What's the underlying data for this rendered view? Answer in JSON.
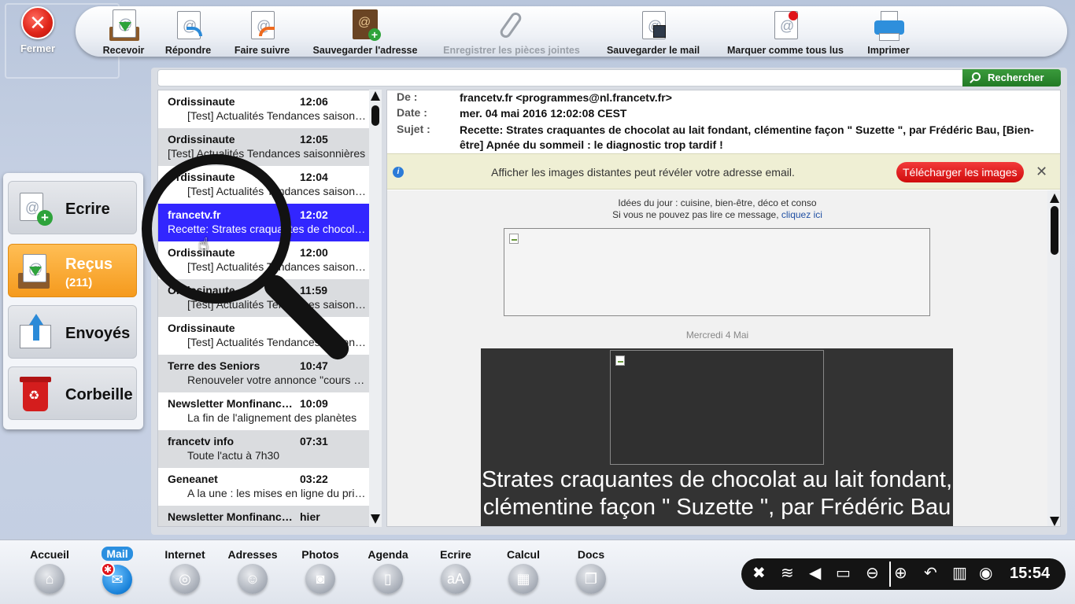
{
  "close": {
    "label": "Fermer"
  },
  "toolbar": {
    "buttons": [
      {
        "label": "Recevoir"
      },
      {
        "label": "Répondre"
      },
      {
        "label": "Faire suivre"
      },
      {
        "label": "Sauvegarder l'adresse"
      },
      {
        "label": "Enregistrer les pièces jointes"
      },
      {
        "label": "Sauvegarder le mail"
      },
      {
        "label": "Marquer comme tous lus"
      },
      {
        "label": "Imprimer"
      }
    ]
  },
  "sidebar": {
    "items": [
      {
        "label": "Ecrire"
      },
      {
        "label": "Reçus",
        "count": "(211)"
      },
      {
        "label": "Envoyés"
      },
      {
        "label": "Corbeille"
      }
    ]
  },
  "search": {
    "button_label": "Rechercher",
    "value": ""
  },
  "mail_list": [
    {
      "from": "Ordissinaute",
      "time": "12:06",
      "subject": "[Test] Actualités Tendances saisonnières"
    },
    {
      "from": "Ordissinaute",
      "time": "12:05",
      "subject": "[Test] Actualités Tendances saisonnières"
    },
    {
      "from": "Ordissinaute",
      "time": "12:04",
      "subject": "[Test] Actualités Tendances saisonnières"
    },
    {
      "from": "francetv.fr",
      "time": "12:02",
      "subject": "Recette: Strates craquantes de chocolat au lait fondant"
    },
    {
      "from": "Ordissinaute",
      "time": "12:00",
      "subject": "[Test] Actualités Tendances saisonnières"
    },
    {
      "from": "Ordissinaute",
      "time": "11:59",
      "subject": "[Test] Actualités Tendances saisonnières"
    },
    {
      "from": "Ordissinaute",
      "time": "",
      "subject": "[Test] Actualités Tendances saisonnières"
    },
    {
      "from": "Terre des Seniors",
      "time": "10:47",
      "subject": "Renouveler votre annonce \"cours de\""
    },
    {
      "from": "Newsletter Monfinancier",
      "time": "10:09",
      "subject": "La fin de l'alignement des planètes"
    },
    {
      "from": "francetv info",
      "time": "07:31",
      "subject": "Toute l'actu à 7h30"
    },
    {
      "from": "Geneanet",
      "time": "03:22",
      "subject": "A la une : les mises en ligne du printemps"
    },
    {
      "from": "Newsletter Monfinancier",
      "time": "hier",
      "subject": ""
    }
  ],
  "mail_header": {
    "from_label": "De :",
    "from_value": "francetv.fr <programmes@nl.francetv.fr>",
    "date_label": "Date :",
    "date_value": "mer. 04 mai 2016 12:02:08 CEST",
    "subject_label": "Sujet :",
    "subject_value": "Recette: Strates craquantes de chocolat au lait fondant, clémentine façon \" Suzette \", par Frédéric Bau, [Bien-être] Apnée du sommeil : le diagnostic trop tardif !"
  },
  "notice": {
    "text": "Afficher les images distantes peut révéler votre adresse email.",
    "button_label": "Télécharger les images"
  },
  "mail_body": {
    "line1": "Idées du jour : cuisine, bien-être, déco et conso",
    "line2_prefix": "Si vous ne pouvez pas lire ce message,",
    "line2_link": "cliquez ici",
    "date_line": "Mercredi 4 Mai",
    "headline": "Strates craquantes de chocolat au lait fondant, clémentine façon \" Suzette \", par Frédéric Bau"
  },
  "dock": {
    "items": [
      {
        "label": "Accueil",
        "icon": "home-icon"
      },
      {
        "label": "Mail",
        "icon": "mail-icon"
      },
      {
        "label": "Internet",
        "icon": "globe-icon"
      },
      {
        "label": "Adresses",
        "icon": "contacts-icon"
      },
      {
        "label": "Photos",
        "icon": "camera-icon"
      },
      {
        "label": "Agenda",
        "icon": "agenda-icon"
      },
      {
        "label": "Ecrire",
        "icon": "text-icon"
      },
      {
        "label": "Calcul",
        "icon": "calculator-icon"
      },
      {
        "label": "Docs",
        "icon": "documents-icon"
      }
    ],
    "aa_glyph": "aA"
  },
  "tray": {
    "time": "15:54"
  },
  "colors": {
    "selected_row": "#3226ff",
    "accent_orange": "#f59a1d",
    "search_green": "#227a25",
    "alert_red": "#d00c0c"
  }
}
